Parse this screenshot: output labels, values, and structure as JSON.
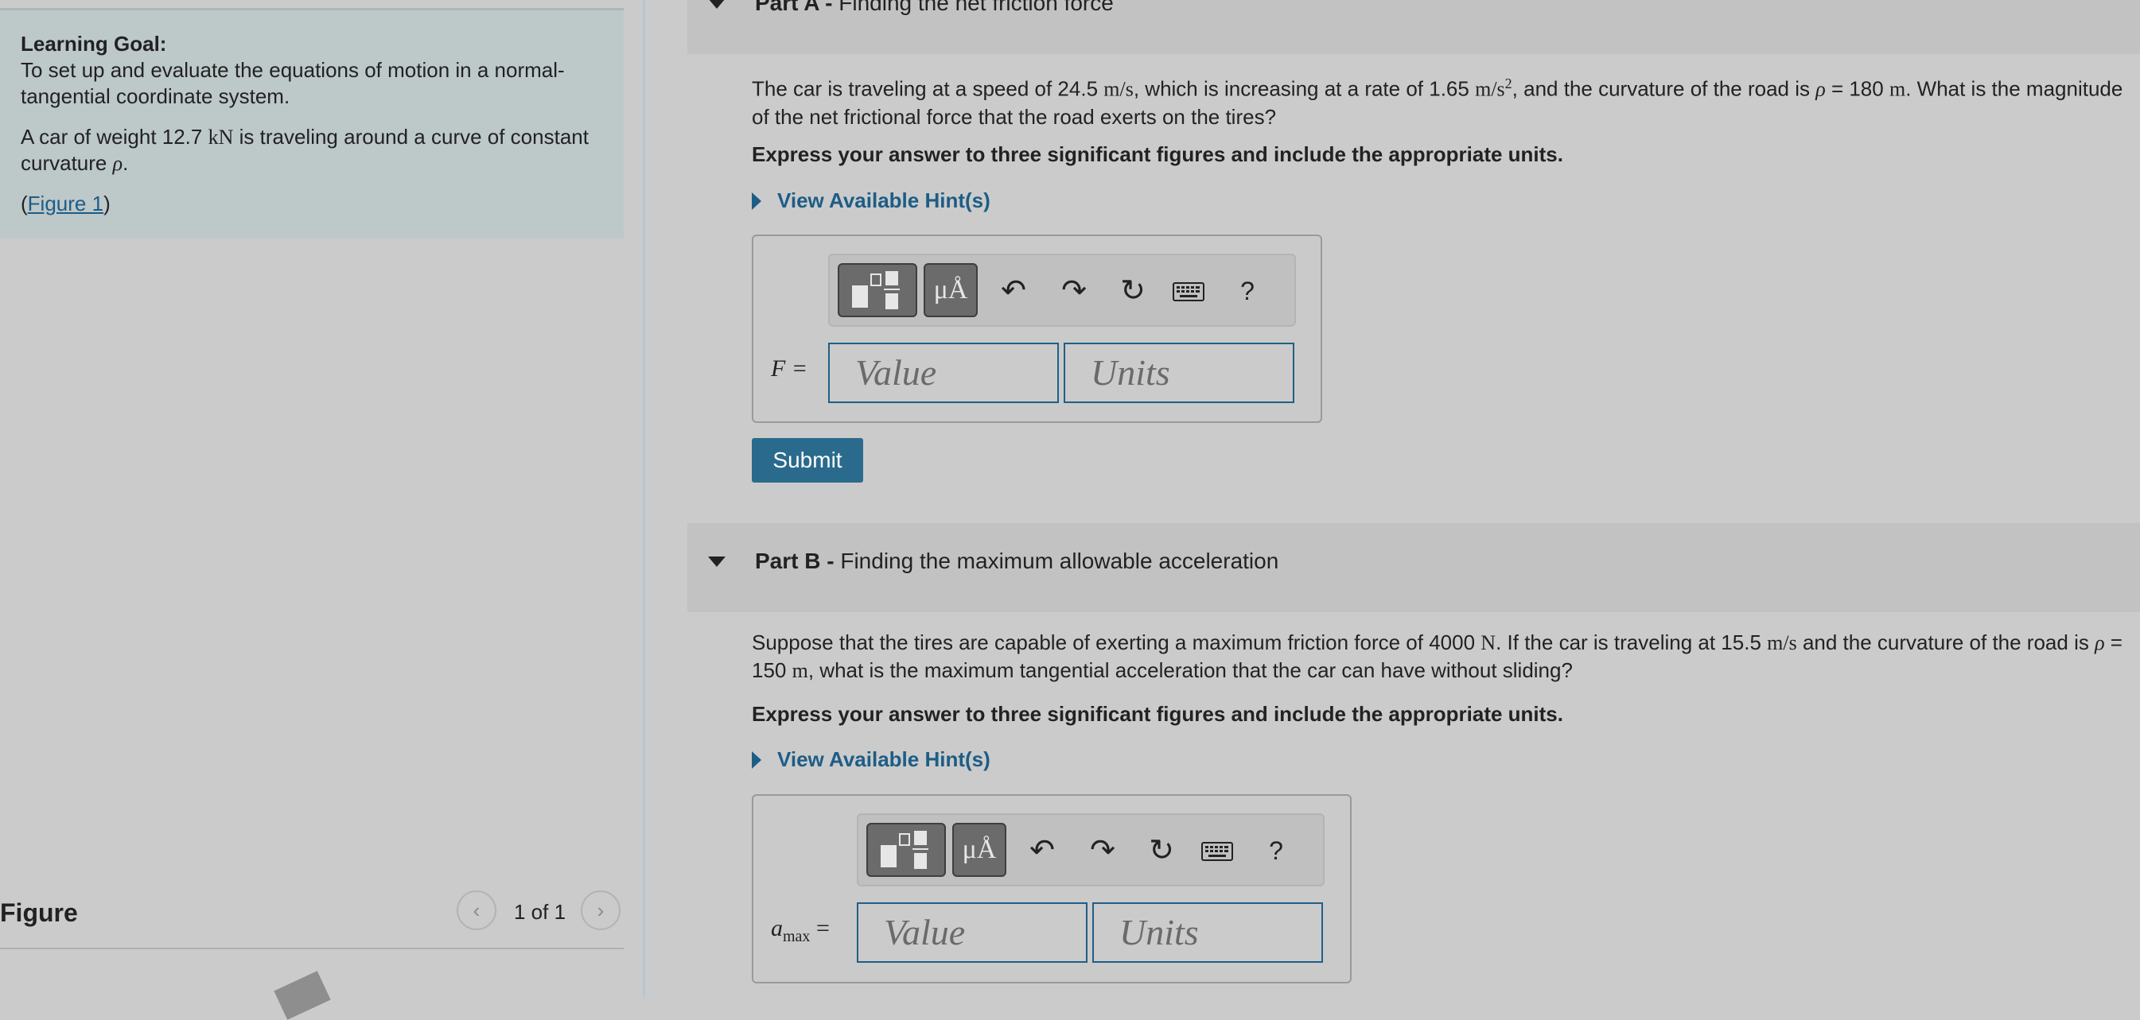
{
  "left": {
    "goal_title": "Learning Goal:",
    "goal_text": "To set up and evaluate the equations of motion in a normal-tangential coordinate system.",
    "intro_pre": "A car of weight 12.7",
    "intro_unit": "kN",
    "intro_post": " is traveling around a curve of constant curvature ",
    "intro_rho": "ρ",
    "intro_end": ".",
    "figure_link_open": "(",
    "figure_link": "Figure 1",
    "figure_link_close": ")",
    "figure_title": "Figure",
    "pager_text": "1 of 1",
    "prev_icon": "‹",
    "next_icon": "›"
  },
  "partA": {
    "title_bold": "Part A -",
    "title": "Finding the net friction force",
    "question_1": "The car is traveling at a speed of 24.5",
    "speed_unit": "m/s",
    "question_2": ", which is increasing at a rate of 1.65",
    "accel_unit": "m/s",
    "accel_exp": "2",
    "question_3": ", and the curvature of the road is ",
    "rho": "ρ",
    "question_4": " = 180",
    "m_unit": "m",
    "question_5": ". What is the magnitude of the net frictional force that the road exerts on the tires?",
    "instructions": "Express your answer to three significant figures and include the appropriate units.",
    "hint_label": "View Available Hint(s)",
    "var_label": "F =",
    "value_placeholder": "Value",
    "units_placeholder": "Units",
    "submit_label": "Submit"
  },
  "partB": {
    "title_bold": "Part B -",
    "title": "Finding the maximum allowable acceleration",
    "question_1": "Suppose that the tires are capable of exerting a maximum friction force of 4000",
    "force_unit": "N",
    "question_2": ". If the car is traveling at 15.5",
    "speed_unit": "m/s",
    "question_3": " and the curvature of the road is ",
    "rho": "ρ",
    "question_4": " = 150",
    "m_unit": "m",
    "question_5": ", what is the maximum tangential acceleration that the car can have without sliding?",
    "instructions": "Express your answer to three significant figures and include the appropriate units.",
    "hint_label": "View Available Hint(s)",
    "var_main": "a",
    "var_sub": "max",
    "var_eq": "=",
    "value_placeholder": "Value",
    "units_placeholder": "Units"
  },
  "toolbar": {
    "units_button_label": "μÅ",
    "undo_icon": "↶",
    "redo_icon": "↷",
    "reset_icon": "↻",
    "help_label": "?"
  }
}
